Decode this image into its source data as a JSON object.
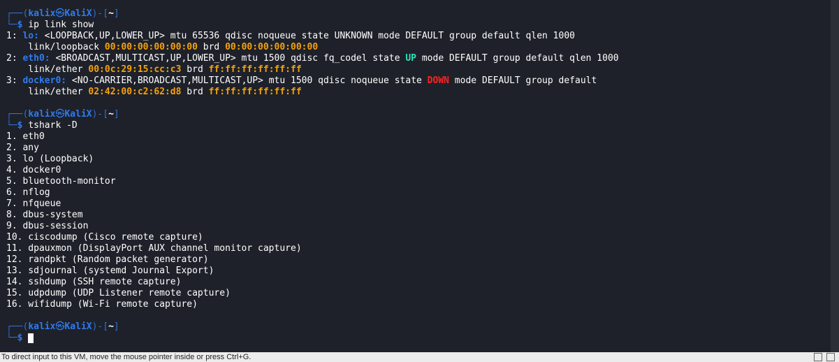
{
  "prompt": {
    "user": "kalix",
    "symbol": "㉿",
    "host": "KaliX",
    "dir": "~"
  },
  "commands": {
    "ip": "ip link show",
    "tshark": "tshark -D"
  },
  "ip_output": {
    "lo_num": "1:",
    "lo_name": "lo:",
    "lo_rest": " <LOOPBACK,UP,LOWER_UP> mtu 65536 qdisc noqueue state UNKNOWN mode DEFAULT group default qlen 1000",
    "lo_link": "    link/loopback ",
    "lo_mac": "00:00:00:00:00:00",
    "lo_brd": " brd ",
    "lo_brdmac": "00:00:00:00:00:00",
    "eth0_num": "2:",
    "eth0_name": "eth0:",
    "eth0_rest1": " <BROADCAST,MULTICAST,UP,LOWER_UP> mtu 1500 qdisc fq_codel state ",
    "eth0_state": "UP",
    "eth0_rest2": " mode DEFAULT group default qlen 1000",
    "eth0_link": "    link/ether ",
    "eth0_mac": "00:0c:29:15:cc:c3",
    "eth0_brd": " brd ",
    "eth0_brdmac": "ff:ff:ff:ff:ff:ff",
    "docker_num": "3:",
    "docker_name": "docker0:",
    "docker_rest1": " <NO-CARRIER,BROADCAST,MULTICAST,UP> mtu 1500 qdisc noqueue state ",
    "docker_state": "DOWN",
    "docker_rest2": " mode DEFAULT group default",
    "docker_link": "    link/ether ",
    "docker_mac": "02:42:00:c2:62:d8",
    "docker_brd": " brd ",
    "docker_brdmac": "ff:ff:ff:ff:ff:ff"
  },
  "tshark_output": [
    "1. eth0",
    "2. any",
    "3. lo (Loopback)",
    "4. docker0",
    "5. bluetooth-monitor",
    "6. nflog",
    "7. nfqueue",
    "8. dbus-system",
    "9. dbus-session",
    "10. ciscodump (Cisco remote capture)",
    "11. dpauxmon (DisplayPort AUX channel monitor capture)",
    "12. randpkt (Random packet generator)",
    "13. sdjournal (systemd Journal Export)",
    "14. sshdump (SSH remote capture)",
    "15. udpdump (UDP Listener remote capture)",
    "16. wifidump (Wi-Fi remote capture)"
  ],
  "status_bar": {
    "text": "To direct input to this VM, move the mouse pointer inside or press Ctrl+G."
  },
  "colors": {
    "background": "#1e2129",
    "prompt": "#2f7bf0",
    "mac": "#f5a10e",
    "up": "#2ee0b8",
    "down": "#ff2222"
  }
}
